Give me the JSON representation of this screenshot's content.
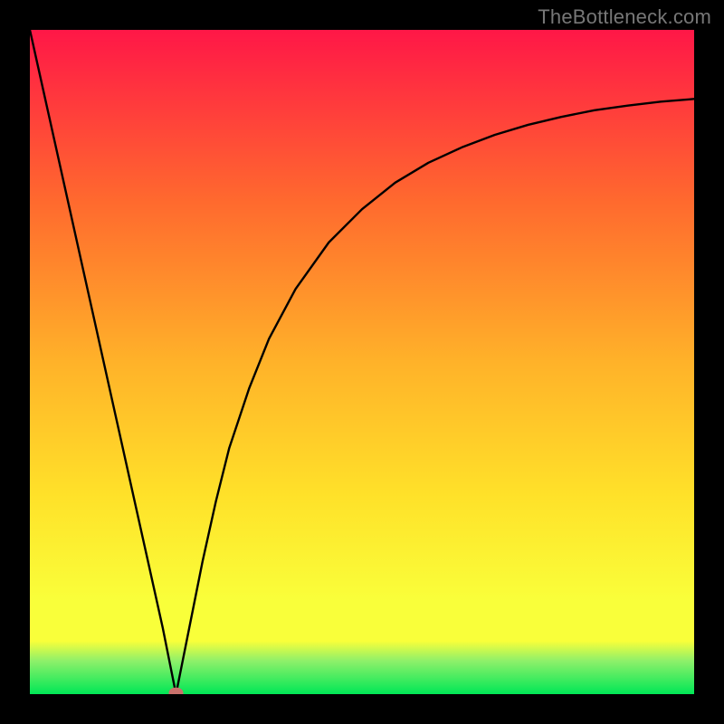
{
  "watermark": "TheBottleneck.com",
  "colors": {
    "bg_black": "#000000",
    "gradient_top": "#ff1747",
    "gradient_upper_mid": "#ff6a2e",
    "gradient_mid": "#ffb229",
    "gradient_lower_mid": "#ffe129",
    "gradient_low": "#f9ff3a",
    "gradient_green_band": "#8ef06a",
    "gradient_bottom": "#00e756",
    "curve": "#000000",
    "marker": "#c9716b"
  },
  "chart_data": {
    "type": "line",
    "title": "",
    "xlabel": "",
    "ylabel": "",
    "xlim": [
      0,
      100
    ],
    "ylim": [
      0,
      100
    ],
    "notch_x": 22,
    "marker": {
      "x": 22,
      "y": 0.2,
      "rx": 1.1,
      "ry": 0.8
    },
    "curve": [
      {
        "x": 0.0,
        "y": 100.0
      },
      {
        "x": 2.0,
        "y": 91.0
      },
      {
        "x": 4.0,
        "y": 82.0
      },
      {
        "x": 6.0,
        "y": 73.0
      },
      {
        "x": 8.0,
        "y": 64.0
      },
      {
        "x": 10.0,
        "y": 55.0
      },
      {
        "x": 12.0,
        "y": 46.0
      },
      {
        "x": 14.0,
        "y": 37.0
      },
      {
        "x": 16.0,
        "y": 28.0
      },
      {
        "x": 18.0,
        "y": 19.0
      },
      {
        "x": 20.0,
        "y": 10.0
      },
      {
        "x": 21.0,
        "y": 5.0
      },
      {
        "x": 22.0,
        "y": 0.0
      },
      {
        "x": 23.0,
        "y": 5.0
      },
      {
        "x": 24.0,
        "y": 10.0
      },
      {
        "x": 26.0,
        "y": 20.0
      },
      {
        "x": 28.0,
        "y": 29.0
      },
      {
        "x": 30.0,
        "y": 37.0
      },
      {
        "x": 33.0,
        "y": 46.0
      },
      {
        "x": 36.0,
        "y": 53.5
      },
      {
        "x": 40.0,
        "y": 61.0
      },
      {
        "x": 45.0,
        "y": 68.0
      },
      {
        "x": 50.0,
        "y": 73.0
      },
      {
        "x": 55.0,
        "y": 77.0
      },
      {
        "x": 60.0,
        "y": 80.0
      },
      {
        "x": 65.0,
        "y": 82.3
      },
      {
        "x": 70.0,
        "y": 84.2
      },
      {
        "x": 75.0,
        "y": 85.7
      },
      {
        "x": 80.0,
        "y": 86.9
      },
      {
        "x": 85.0,
        "y": 87.9
      },
      {
        "x": 90.0,
        "y": 88.6
      },
      {
        "x": 95.0,
        "y": 89.2
      },
      {
        "x": 100.0,
        "y": 89.6
      }
    ]
  }
}
